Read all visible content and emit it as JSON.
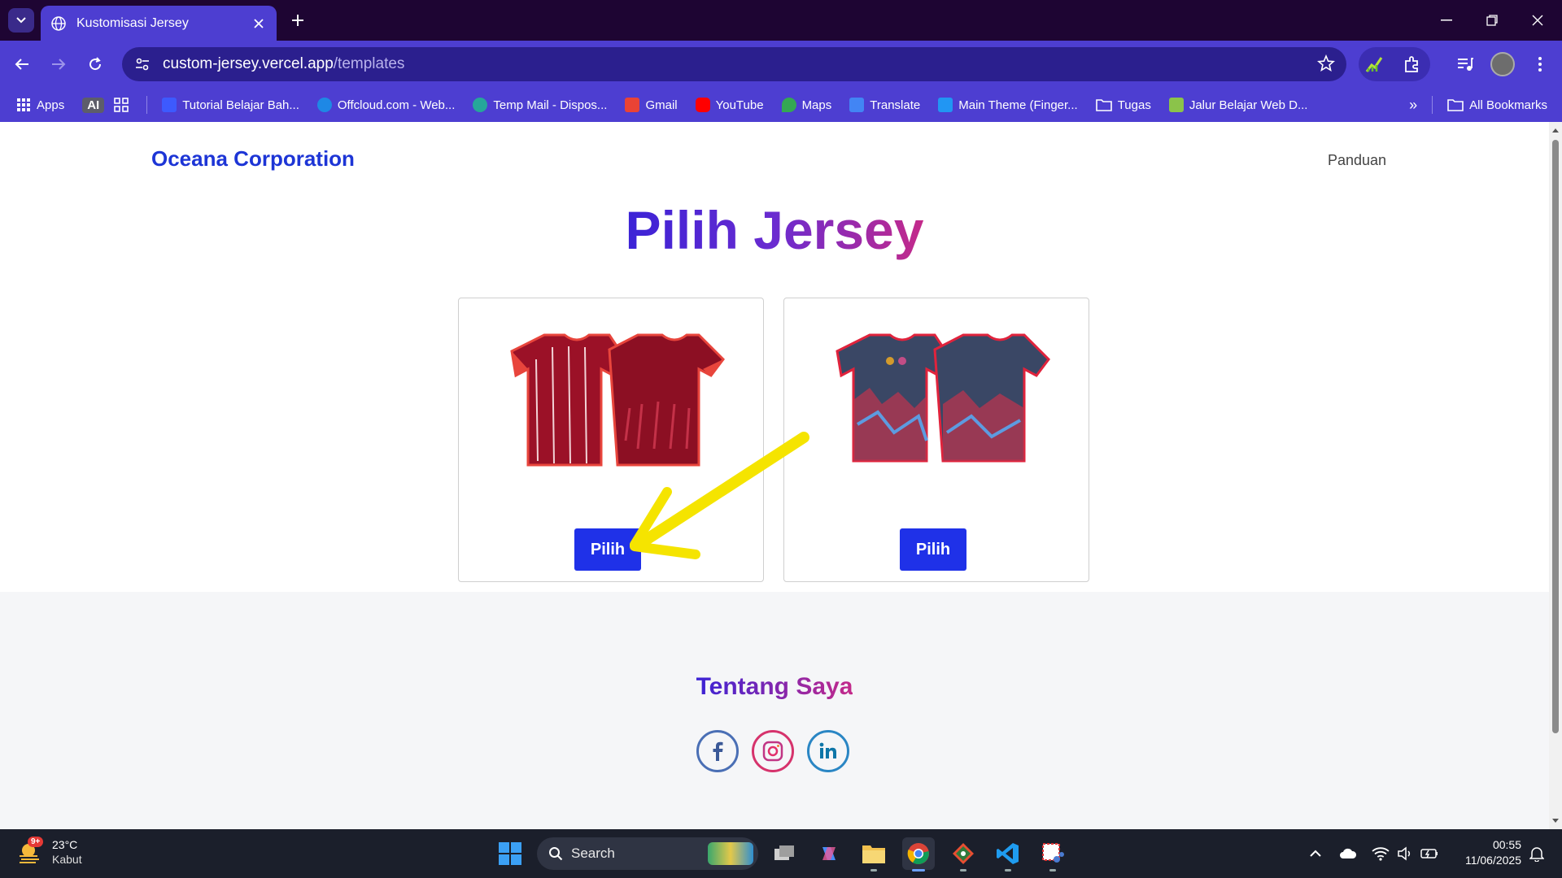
{
  "browser": {
    "tab_title": "Kustomisasi Jersey",
    "url_host": "custom-jersey.vercel.app",
    "url_path": "/templates",
    "bookmarks": [
      {
        "label": "Apps",
        "color": "#ffffff"
      },
      {
        "label": "AI",
        "color": "#444444"
      },
      {
        "label": "",
        "color": "#ffffff"
      },
      {
        "label": "Tutorial Belajar Bah...",
        "color": "#3d5afe"
      },
      {
        "label": "Offcloud.com - Web...",
        "color": "#1e88e5"
      },
      {
        "label": "Temp Mail - Dispos...",
        "color": "#26a69a"
      },
      {
        "label": "Gmail",
        "color": "#ea4335"
      },
      {
        "label": "YouTube",
        "color": "#ff0000"
      },
      {
        "label": "Maps",
        "color": "#34a853"
      },
      {
        "label": "Translate",
        "color": "#4285f4"
      },
      {
        "label": "Main Theme (Finger...",
        "color": "#2196f3"
      },
      {
        "label": "Tugas",
        "color": "#ffd54f"
      },
      {
        "label": "Jalur Belajar Web D...",
        "color": "#8bc34a"
      }
    ],
    "all_bookmarks": "All Bookmarks",
    "more_bookmarks": "»"
  },
  "site": {
    "brand": "Oceana Corporation",
    "nav_link": "Panduan",
    "hero_title": "Pilih Jersey",
    "cards": [
      {
        "button": "Pilih",
        "primary": "#9b1127",
        "accent": "#e8453c"
      },
      {
        "button": "Pilih",
        "primary": "#3a4765",
        "accent": "#e0233c"
      }
    ],
    "footer_title": "Tentang Saya",
    "socials": [
      "facebook-icon",
      "instagram-icon",
      "linkedin-icon"
    ]
  },
  "taskbar": {
    "weather_badge": "9+",
    "temperature": "23°C",
    "condition": "Kabut",
    "search_label": "Search",
    "time": "00:55",
    "date": "11/06/2025"
  }
}
